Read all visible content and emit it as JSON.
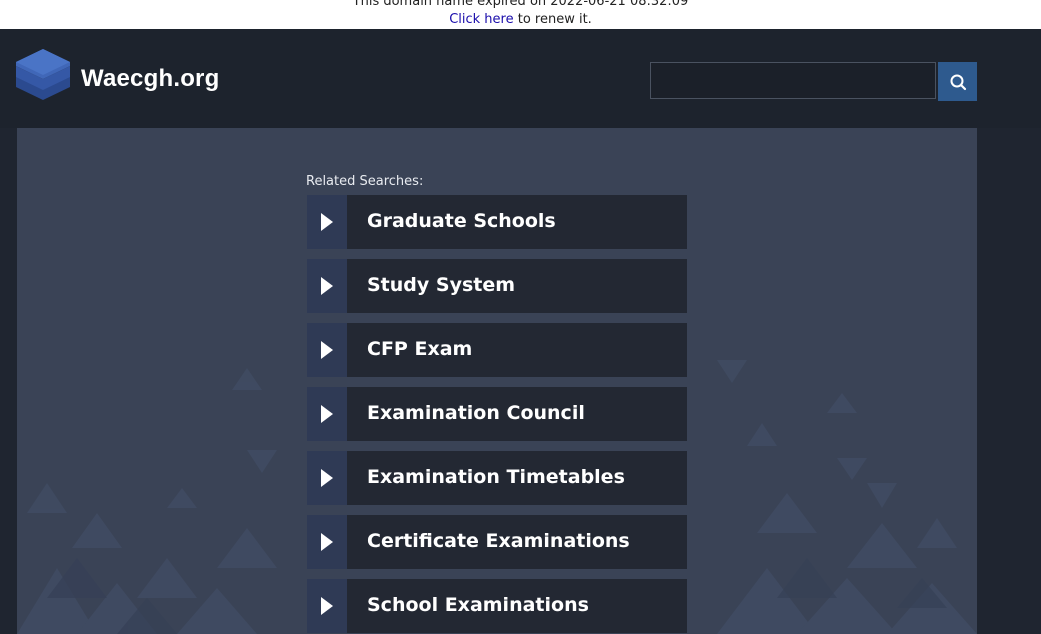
{
  "notice": {
    "expired_text": "This domain name expired on 2022-06-21 08:32:09",
    "renew_link": "Click here",
    "renew_suffix": " to renew it."
  },
  "header": {
    "site_name": "Waecgh.org",
    "search": {
      "value": "",
      "placeholder": ""
    },
    "search_icon": "search-icon"
  },
  "main": {
    "related_label": "Related Searches:",
    "links": [
      {
        "label": "Graduate Schools"
      },
      {
        "label": "Study System"
      },
      {
        "label": "CFP Exam"
      },
      {
        "label": "Examination Council"
      },
      {
        "label": "Examination Timetables"
      },
      {
        "label": "Certificate Examinations"
      },
      {
        "label": "School Examinations"
      }
    ]
  },
  "colors": {
    "header_bg": "#1d232d",
    "main_bg": "#3a4356",
    "link_bg": "#232833",
    "arrow_bg": "#2f3a55",
    "search_button": "#2e5a8e"
  }
}
